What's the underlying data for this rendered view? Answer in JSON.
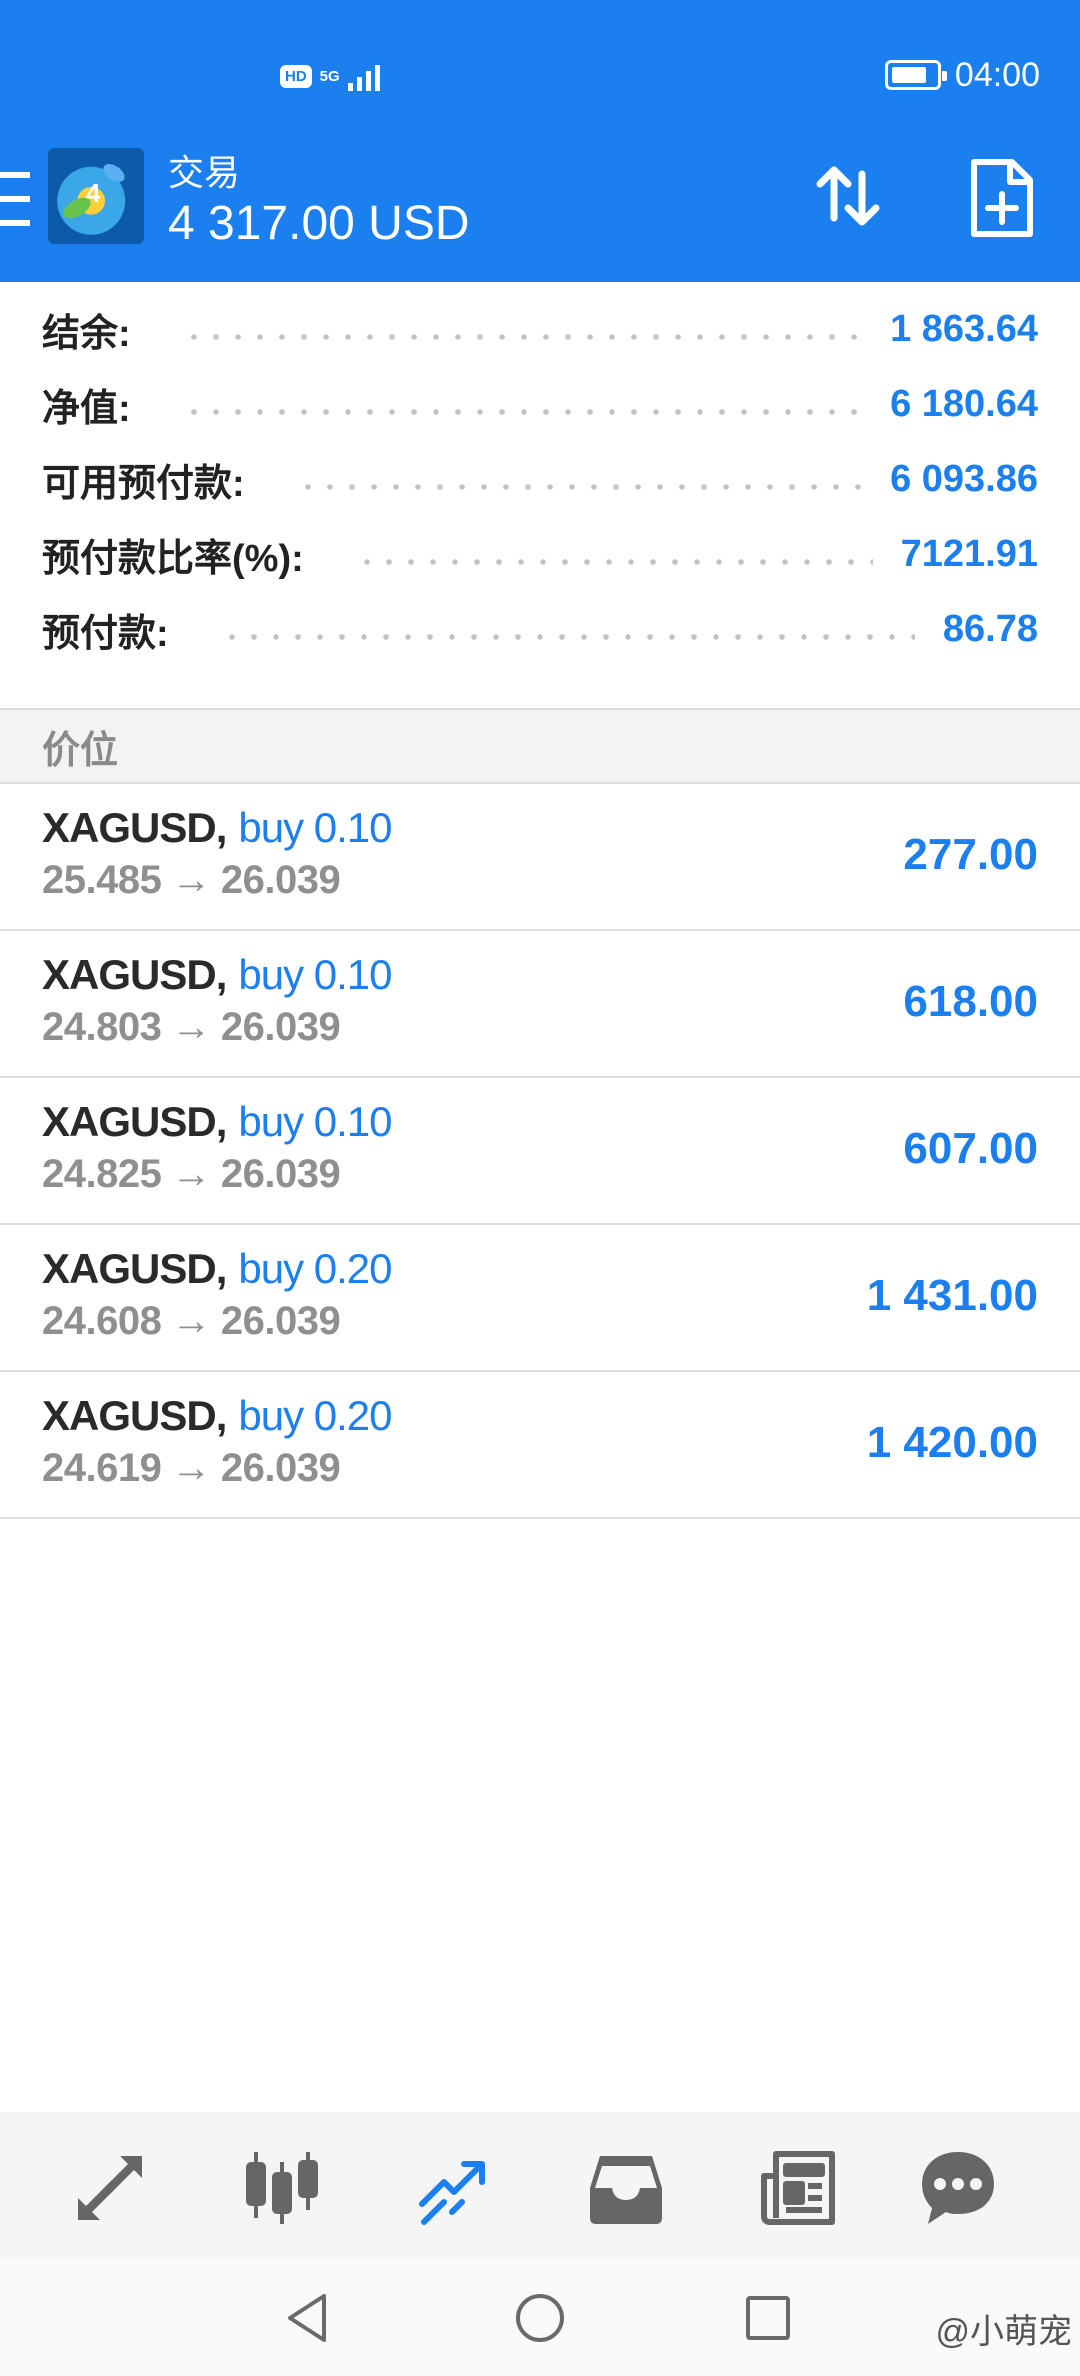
{
  "status_bar": {
    "network_badge": "HD",
    "network_type": "5G",
    "time": "04:00"
  },
  "app_bar": {
    "title": "交易",
    "balance": "4 317.00 USD"
  },
  "account_summary": [
    {
      "label": "结余:",
      "value": "1 863.64"
    },
    {
      "label": "净值:",
      "value": "6 180.64"
    },
    {
      "label": "可用预付款:",
      "value": "6 093.86"
    },
    {
      "label": "预付款比率(%):",
      "value": "7121.91"
    },
    {
      "label": "预付款:",
      "value": "86.78"
    }
  ],
  "positions_section": {
    "title": "价位"
  },
  "positions": [
    {
      "symbol": "XAGUSD",
      "comma": ",",
      "type": "buy 0.10",
      "open_price": "25.485",
      "arrow": "→",
      "current_price": "26.039",
      "profit": "277.00"
    },
    {
      "symbol": "XAGUSD",
      "comma": ",",
      "type": "buy 0.10",
      "open_price": "24.803",
      "arrow": "→",
      "current_price": "26.039",
      "profit": "618.00"
    },
    {
      "symbol": "XAGUSD",
      "comma": ",",
      "type": "buy 0.10",
      "open_price": "24.825",
      "arrow": "→",
      "current_price": "26.039",
      "profit": "607.00"
    },
    {
      "symbol": "XAGUSD",
      "comma": ",",
      "type": "buy 0.20",
      "open_price": "24.608",
      "arrow": "→",
      "current_price": "26.039",
      "profit": "1 431.00"
    },
    {
      "symbol": "XAGUSD",
      "comma": ",",
      "type": "buy 0.20",
      "open_price": "24.619",
      "arrow": "→",
      "current_price": "26.039",
      "profit": "1 420.00"
    }
  ],
  "bottom_nav": {
    "items": [
      "quotes-icon",
      "chart-icon",
      "trade-icon",
      "history-icon",
      "news-icon",
      "chat-icon"
    ],
    "active": "trade-icon"
  },
  "colors": {
    "accent": "#1b7ff0",
    "label_dark": "#222222",
    "muted": "#8f8f8f",
    "nav_icon": "#666666"
  },
  "watermark": "@小萌宠"
}
